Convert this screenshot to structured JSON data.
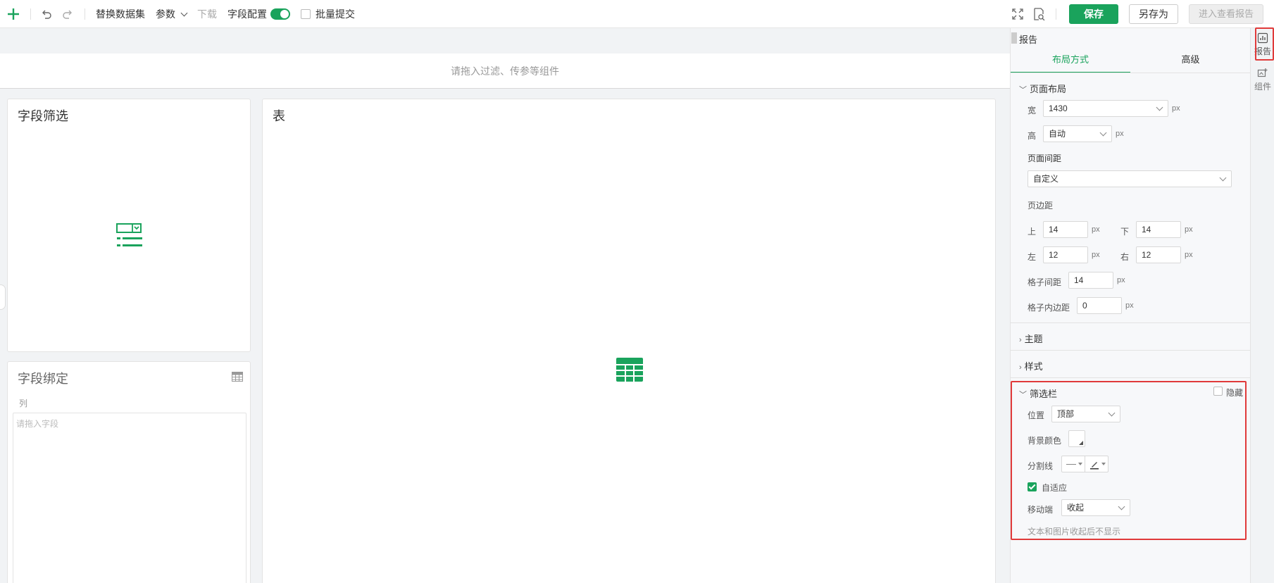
{
  "toolbar": {
    "replace_dataset": "替换数据集",
    "params": "参数",
    "download": "下载",
    "field_config": "字段配置",
    "field_config_on": true,
    "batch_submit": "批量提交",
    "save": "保存",
    "save_as": "另存为",
    "enter_report": "进入查看报告"
  },
  "canvas": {
    "filter_dropzone": "请拖入过滤、传参等组件",
    "field_filter_title": "字段筛选",
    "field_binding_title": "字段绑定",
    "column_label": "列",
    "drag_field_placeholder": "请拖入字段",
    "table_title": "表"
  },
  "panel": {
    "title": "报告",
    "tabs": [
      "布局方式",
      "高级"
    ],
    "active_tab": "布局方式",
    "page_layout": {
      "title": "页面布局",
      "width_label": "宽",
      "width_value": "1430",
      "height_label": "高",
      "height_value": "自动",
      "unit": "px"
    },
    "page_spacing": {
      "title": "页面间距",
      "mode": "自定义",
      "margin_title": "页边距",
      "top_label": "上",
      "top": "14",
      "bottom_label": "下",
      "bottom": "14",
      "left_label": "左",
      "left": "12",
      "right_label": "右",
      "right": "12",
      "grid_gap_label": "格子间距",
      "grid_gap": "14",
      "grid_padding_label": "格子内边距",
      "grid_padding": "0"
    },
    "theme": "主题",
    "style": "样式",
    "filter_bar": {
      "title": "筛选栏",
      "hide_label": "隐藏",
      "position_label": "位置",
      "position_value": "顶部",
      "bg_color_label": "背景颜色",
      "divider_label": "分割线",
      "adaptive_label": "自适应",
      "adaptive_checked": true,
      "mobile_label": "移动端",
      "mobile_value": "收起",
      "hint": "文本和图片收起后不显示"
    }
  },
  "rail": {
    "report": "报告",
    "component": "组件"
  },
  "colors": {
    "accent": "#1aa35c",
    "highlight": "#e03a3a"
  }
}
